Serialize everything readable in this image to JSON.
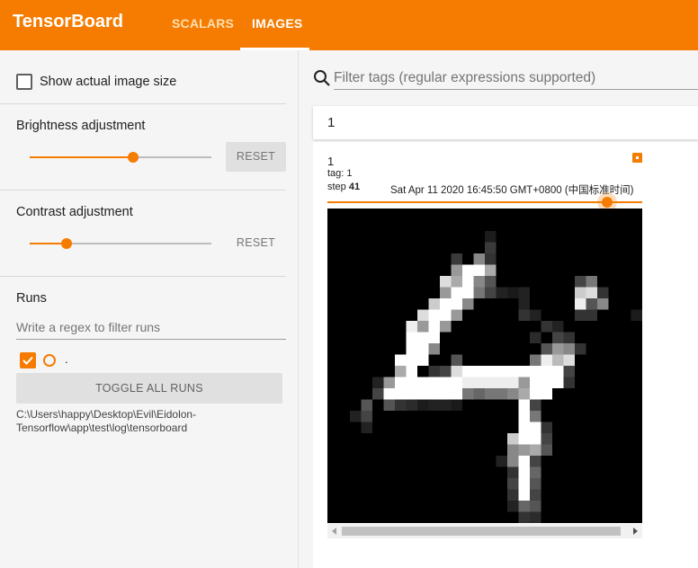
{
  "app": {
    "title": "TensorBoard"
  },
  "nav": {
    "tabs": [
      {
        "label": "SCALARS"
      },
      {
        "label": "IMAGES"
      }
    ]
  },
  "sidebar": {
    "show_actual_size_label": "Show actual image size",
    "brightness": {
      "title": "Brightness adjustment",
      "reset_label": "RESET",
      "value": 0.5
    },
    "contrast": {
      "title": "Contrast adjustment",
      "reset_label": "RESET",
      "value": 0.2
    },
    "runs": {
      "title": "Runs",
      "filter_placeholder": "Write a regex to filter runs",
      "items": [
        {
          "name": ".",
          "checked": true
        }
      ],
      "toggle_all_label": "TOGGLE ALL RUNS",
      "log_dir": "C:\\Users\\happy\\Desktop\\Evil\\Eidolon-Tensorflow\\app\\test\\log\\tensorboard"
    }
  },
  "main": {
    "filter_placeholder": "Filter tags (regular expressions supported)",
    "group_name": "1",
    "card": {
      "title": "1",
      "tag": "tag: 1",
      "step_label": "step",
      "step_value": "41",
      "timestamp": "Sat Apr 11 2020 16:45:50 GMT+0800 (中国标准时间)",
      "step_position": 0.89
    }
  },
  "colors": {
    "accent": "#f57c00",
    "header": "#f57c00"
  },
  "icons": {
    "search": "search-icon",
    "expand": "expand-icon",
    "check": "check-icon"
  }
}
